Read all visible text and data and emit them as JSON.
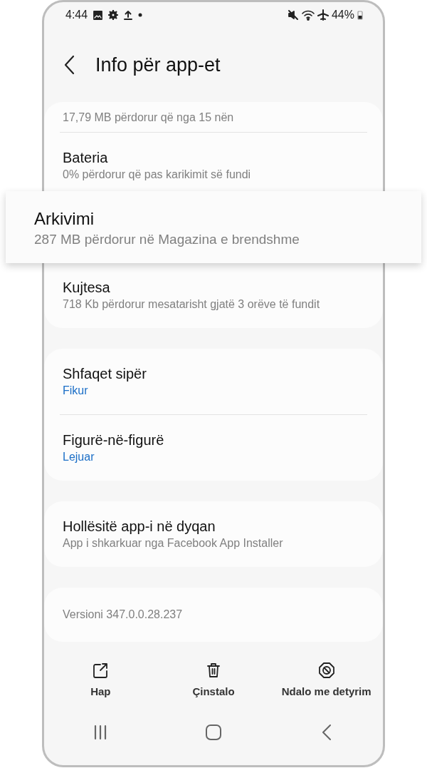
{
  "status_bar": {
    "time": "4:44",
    "battery": "44%"
  },
  "header": {
    "title": "Info për app-et"
  },
  "groups": [
    {
      "items": [
        {
          "kind": "info",
          "divider": false,
          "subtitle": "17,79 MB përdorur që nga 15 nën"
        },
        {
          "kind": "info",
          "divider": true,
          "title": "Bateria",
          "subtitle": "0% përdorur që pas karikimit së fundi"
        },
        {
          "kind": "callout",
          "divider": false,
          "title": "Arkivimi",
          "subtitle": "287 MB përdorur në Magazina e brendshme"
        },
        {
          "kind": "info",
          "divider": false,
          "title": "Kujtesa",
          "subtitle": "718 Kb përdorur mesatarisht gjatë 3 orëve të fundit"
        }
      ]
    },
    {
      "items": [
        {
          "kind": "status",
          "divider": false,
          "title": "Shfaqet sipër",
          "subtitle": "Fikur"
        },
        {
          "kind": "status",
          "divider": true,
          "title": "Figurë-në-figurë",
          "subtitle": "Lejuar"
        }
      ]
    },
    {
      "items": [
        {
          "kind": "info",
          "divider": false,
          "title": "Hollësitë app-i në dyqan",
          "subtitle": "App i shkarkuar nga Facebook App Installer"
        }
      ]
    },
    {
      "items": [
        {
          "kind": "version",
          "divider": false,
          "subtitle": "Versioni 347.0.0.28.237"
        }
      ]
    }
  ],
  "actions": [
    {
      "label": "Hap"
    },
    {
      "label": "Çinstalo"
    },
    {
      "label": "Ndalo me detyrim"
    }
  ]
}
